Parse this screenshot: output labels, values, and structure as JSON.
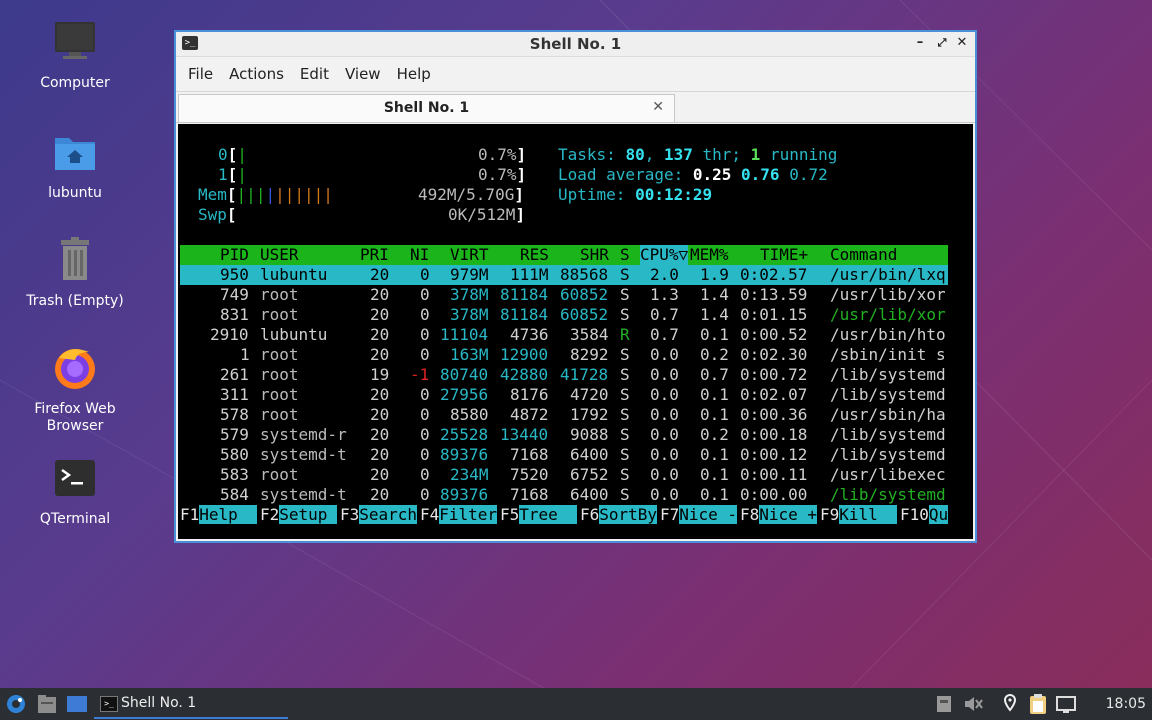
{
  "desktop": {
    "icons": [
      {
        "label": "Computer",
        "icon": "monitor-icon"
      },
      {
        "label": "lubuntu",
        "icon": "home-folder-icon"
      },
      {
        "label": "Trash (Empty)",
        "icon": "trash-icon"
      },
      {
        "label_line1": "Firefox Web",
        "label_line2": "Browser",
        "icon": "firefox-icon"
      },
      {
        "label": "QTerminal",
        "icon": "terminal-icon"
      }
    ]
  },
  "window": {
    "title": "Shell No. 1",
    "buttons": {
      "minimize": "–",
      "maximize": "⤢",
      "close": "✕"
    },
    "menu": [
      "File",
      "Actions",
      "Edit",
      "View",
      "Help"
    ],
    "tab": {
      "label": "Shell No. 1",
      "close": "✕"
    }
  },
  "htop": {
    "cpu0": {
      "label": "0",
      "bar": "|",
      "pct": "0.7%"
    },
    "cpu1": {
      "label": "1",
      "bar": "|",
      "pct": "0.7%"
    },
    "mem": {
      "label": "Mem",
      "bar": "||||||||||",
      "value": "492M/5.70G"
    },
    "swp": {
      "label": "Swp",
      "value": "0K/512M"
    },
    "tasks": {
      "prefix": "Tasks: ",
      "count": "80",
      "sep": ", ",
      "threads": "137",
      "thr": " thr; ",
      "running": "1",
      "running_label": " running"
    },
    "load": {
      "prefix": "Load average: ",
      "l1": "0.25",
      "l5": "0.76",
      "l15": "0.72"
    },
    "uptime": {
      "prefix": "Uptime: ",
      "value": "00:12:29"
    },
    "columns": [
      "PID",
      "USER",
      "PRI",
      "NI",
      "VIRT",
      "RES",
      "SHR",
      "S",
      "CPU%▽",
      "MEM%",
      "TIME+",
      "Command"
    ],
    "processes": [
      {
        "pid": "950",
        "user": "lubuntu",
        "pri": "20",
        "ni": "0",
        "virt": "979M",
        "res": "111M",
        "shr": "88568",
        "s": "S",
        "cpu": "2.0",
        "mem": "1.9",
        "time": "0:02.57",
        "cmd": "/usr/bin/lxq"
      },
      {
        "pid": "749",
        "user": "root",
        "pri": "20",
        "ni": "0",
        "virt": "378M",
        "res": "81184",
        "shr": "60852",
        "s": "S",
        "cpu": "1.3",
        "mem": "1.4",
        "time": "0:13.59",
        "cmd": "/usr/lib/xor"
      },
      {
        "pid": "831",
        "user": "root",
        "pri": "20",
        "ni": "0",
        "virt": "378M",
        "res": "81184",
        "shr": "60852",
        "s": "S",
        "cpu": "0.7",
        "mem": "1.4",
        "time": "0:01.15",
        "cmd": "/usr/lib/xor"
      },
      {
        "pid": "2910",
        "user": "lubuntu",
        "pri": "20",
        "ni": "0",
        "virt": "11104",
        "res": "4736",
        "shr": "3584",
        "s": "R",
        "cpu": "0.7",
        "mem": "0.1",
        "time": "0:00.52",
        "cmd": "/usr/bin/hto"
      },
      {
        "pid": "1",
        "user": "root",
        "pri": "20",
        "ni": "0",
        "virt": "163M",
        "res": "12900",
        "shr": "8292",
        "s": "S",
        "cpu": "0.0",
        "mem": "0.2",
        "time": "0:02.30",
        "cmd": "/sbin/init s"
      },
      {
        "pid": "261",
        "user": "root",
        "pri": "19",
        "ni": "-1",
        "virt": "80740",
        "res": "42880",
        "shr": "41728",
        "s": "S",
        "cpu": "0.0",
        "mem": "0.7",
        "time": "0:00.72",
        "cmd": "/lib/systemd"
      },
      {
        "pid": "311",
        "user": "root",
        "pri": "20",
        "ni": "0",
        "virt": "27956",
        "res": "8176",
        "shr": "4720",
        "s": "S",
        "cpu": "0.0",
        "mem": "0.1",
        "time": "0:02.07",
        "cmd": "/lib/systemd"
      },
      {
        "pid": "578",
        "user": "root",
        "pri": "20",
        "ni": "0",
        "virt": "8580",
        "res": "4872",
        "shr": "1792",
        "s": "S",
        "cpu": "0.0",
        "mem": "0.1",
        "time": "0:00.36",
        "cmd": "/usr/sbin/ha"
      },
      {
        "pid": "579",
        "user": "systemd-r",
        "pri": "20",
        "ni": "0",
        "virt": "25528",
        "res": "13440",
        "shr": "9088",
        "s": "S",
        "cpu": "0.0",
        "mem": "0.2",
        "time": "0:00.18",
        "cmd": "/lib/systemd"
      },
      {
        "pid": "580",
        "user": "systemd-t",
        "pri": "20",
        "ni": "0",
        "virt": "89376",
        "res": "7168",
        "shr": "6400",
        "s": "S",
        "cpu": "0.0",
        "mem": "0.1",
        "time": "0:00.12",
        "cmd": "/lib/systemd"
      },
      {
        "pid": "583",
        "user": "root",
        "pri": "20",
        "ni": "0",
        "virt": "234M",
        "res": "7520",
        "shr": "6752",
        "s": "S",
        "cpu": "0.0",
        "mem": "0.1",
        "time": "0:00.11",
        "cmd": "/usr/libexec"
      },
      {
        "pid": "584",
        "user": "systemd-t",
        "pri": "20",
        "ni": "0",
        "virt": "89376",
        "res": "7168",
        "shr": "6400",
        "s": "S",
        "cpu": "0.0",
        "mem": "0.1",
        "time": "0:00.00",
        "cmd": "/lib/systemd"
      }
    ],
    "fkeys": [
      {
        "key": "F1",
        "label": "Help  "
      },
      {
        "key": "F2",
        "label": "Setup "
      },
      {
        "key": "F3",
        "label": "Search"
      },
      {
        "key": "F4",
        "label": "Filter"
      },
      {
        "key": "F5",
        "label": "Tree  "
      },
      {
        "key": "F6",
        "label": "SortBy"
      },
      {
        "key": "F7",
        "label": "Nice -"
      },
      {
        "key": "F8",
        "label": "Nice +"
      },
      {
        "key": "F9",
        "label": "Kill  "
      },
      {
        "key": "F10",
        "label": "Qu"
      }
    ]
  },
  "taskbar": {
    "task_label": "Shell No. 1",
    "clock": "18:05",
    "tray_icons": [
      "keyboard-layout-icon",
      "volume-muted-icon",
      "location-icon",
      "clipboard-icon",
      "network-icon"
    ]
  },
  "colors": {
    "accent": "#3d7bd6",
    "htop_cyan": "#29b8c6",
    "htop_green": "#1bb51b"
  }
}
